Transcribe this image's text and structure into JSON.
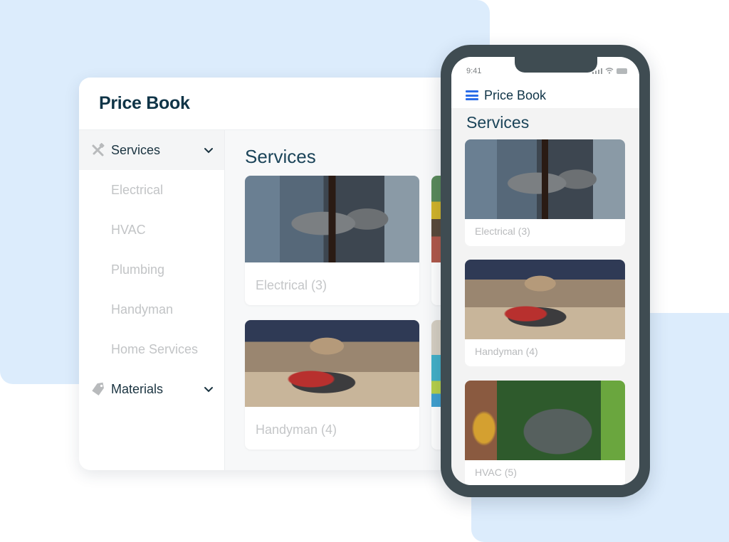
{
  "desktop": {
    "title": "Price Book",
    "sidebar": {
      "groups": [
        {
          "label": "Services",
          "icon": "tools-icon",
          "expanded": true,
          "items": [
            "Electrical",
            "HVAC",
            "Plumbing",
            "Handyman",
            "Home Services"
          ]
        },
        {
          "label": "Materials",
          "icon": "tag-icon",
          "expanded": false,
          "items": []
        }
      ]
    },
    "content": {
      "title": "Services",
      "cards": [
        {
          "label": "Electrical (3)",
          "photo": "electrical panel"
        },
        {
          "label": "Handyman (4)",
          "photo": "power tools"
        }
      ]
    }
  },
  "phone": {
    "status_time": "9:41",
    "title": "Price Book",
    "section": "Services",
    "cards": [
      {
        "label": "Electrical (3)",
        "photo": "electrical panel"
      },
      {
        "label": "Handyman (4)",
        "photo": "power tools"
      },
      {
        "label": "HVAC (5)",
        "photo": "air conditioner unit"
      }
    ]
  },
  "colors": {
    "accent": "#2a6ce8",
    "title": "#0f3447",
    "muted": "#c2c4c6",
    "phone_frame": "#3f4c52",
    "background_blob": "#dcecfc"
  }
}
